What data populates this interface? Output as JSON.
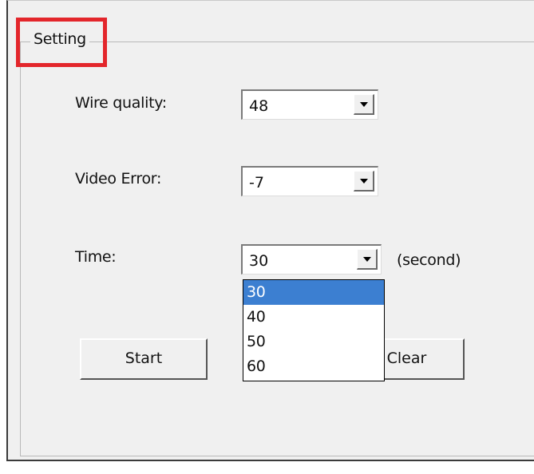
{
  "group_title": "Setting",
  "fields": {
    "wire_quality": {
      "label": "Wire quality:",
      "value": "48"
    },
    "video_error": {
      "label": "Video Error:",
      "value": "-7"
    },
    "time": {
      "label": "Time:",
      "value": "30",
      "unit": "(second)"
    }
  },
  "time_options": [
    "30",
    "40",
    "50",
    "60"
  ],
  "selected_time_option": "30",
  "buttons": {
    "start": "Start",
    "clear": "Clear"
  },
  "highlight_color": "#e3262b",
  "selection_color": "#3c7fd1"
}
